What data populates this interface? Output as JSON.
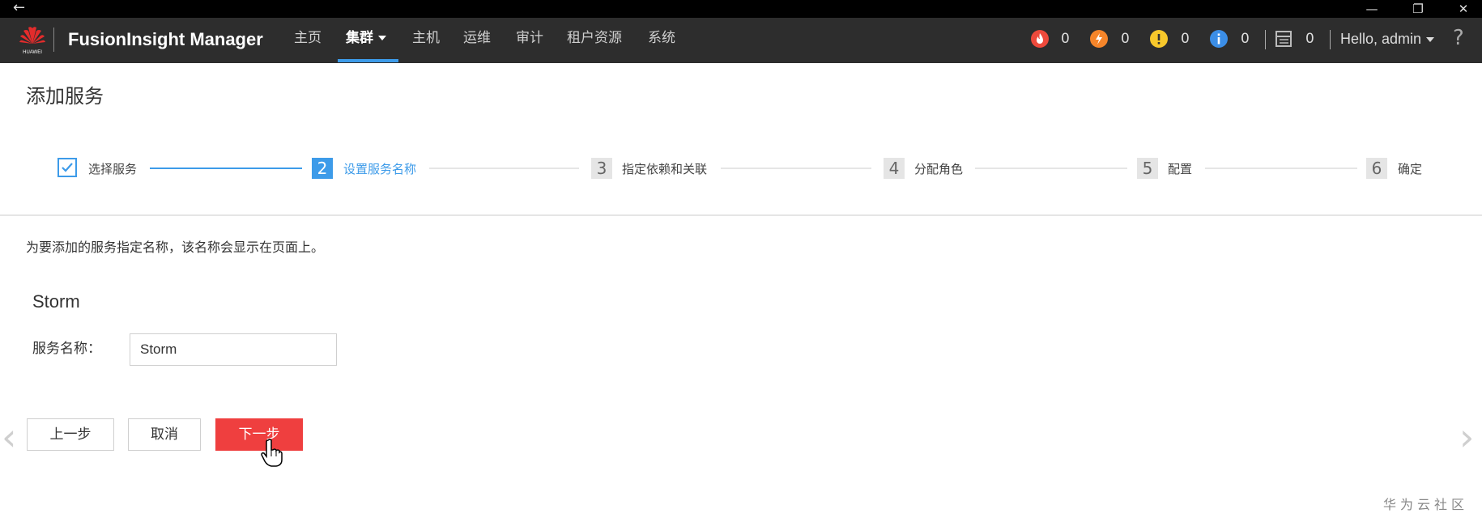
{
  "app": {
    "brand": "FusionInsight Manager",
    "logo_text": "HUAWEI"
  },
  "nav": {
    "items": [
      "主页",
      "集群",
      "主机",
      "运维",
      "审计",
      "租户资源",
      "系统"
    ],
    "active_index": 1
  },
  "alarms": {
    "critical": "0",
    "major": "0",
    "minor": "0",
    "warning": "0",
    "tasks": "0"
  },
  "user": {
    "greeting": "Hello, admin"
  },
  "help_label": "?",
  "page": {
    "title": "添加服务",
    "description": "为要添加的服务指定名称，该名称会显示在页面上。"
  },
  "wizard": {
    "current_step": 2,
    "steps": [
      {
        "num": "1",
        "label": "选择服务",
        "status": "done"
      },
      {
        "num": "2",
        "label": "设置服务名称",
        "status": "current"
      },
      {
        "num": "3",
        "label": "指定依赖和关联",
        "status": "todo"
      },
      {
        "num": "4",
        "label": "分配角色",
        "status": "todo"
      },
      {
        "num": "5",
        "label": "配置",
        "status": "todo"
      },
      {
        "num": "6",
        "label": "确定",
        "status": "todo"
      }
    ]
  },
  "service": {
    "name": "Storm",
    "field_label": "服务名称：",
    "field_value": "Storm"
  },
  "buttons": {
    "prev": "上一步",
    "cancel": "取消",
    "next": "下一步"
  },
  "watermark": "华为云社区",
  "colors": {
    "topbar": "#2d2d2d",
    "accent": "#3d9be9",
    "primary_button": "#ef3f3f",
    "alarm_critical": "#ee4a3c",
    "alarm_major": "#f5852a",
    "alarm_minor": "#f7c82b",
    "alarm_warning": "#3b8ee7"
  }
}
